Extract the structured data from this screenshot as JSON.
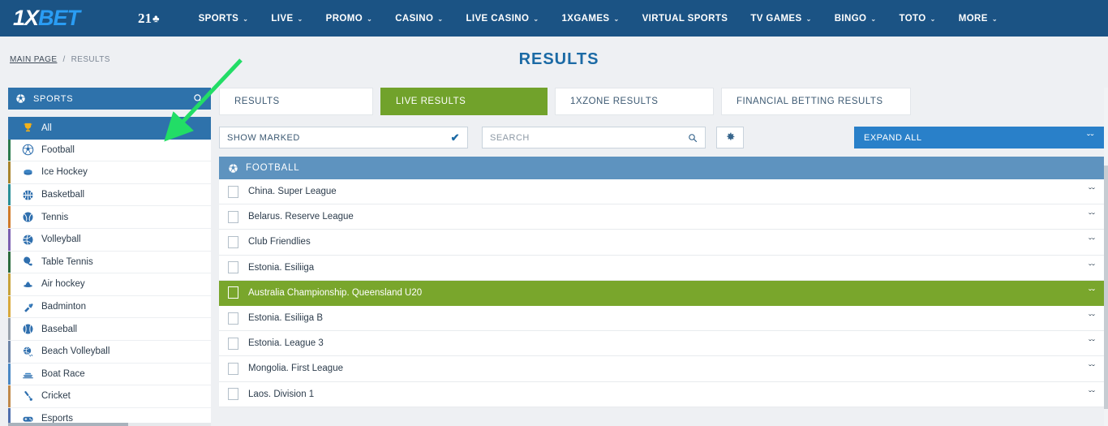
{
  "header": {
    "logo_1x": "1X",
    "logo_bet": "BET",
    "badge_21": "21",
    "badge_clover": "♣",
    "nav": [
      {
        "label": "SPORTS",
        "caret": true
      },
      {
        "label": "LIVE",
        "caret": true
      },
      {
        "label": "PROMO",
        "caret": true
      },
      {
        "label": "CASINO",
        "caret": true
      },
      {
        "label": "LIVE CASINO",
        "caret": true
      },
      {
        "label": "1XGAMES",
        "caret": true
      },
      {
        "label": "VIRTUAL SPORTS",
        "caret": false
      },
      {
        "label": "TV GAMES",
        "caret": true
      },
      {
        "label": "BINGO",
        "caret": true
      },
      {
        "label": "TOTO",
        "caret": true
      },
      {
        "label": "MORE",
        "caret": true
      }
    ],
    "caret_glyph": "⌄"
  },
  "breadcrumb": {
    "home": "MAIN PAGE",
    "separator": "/",
    "current": "RESULTS"
  },
  "page_title": "RESULTS",
  "sidebar": {
    "header_label": "SPORTS",
    "items": [
      {
        "label": "All",
        "icon": "trophy-icon",
        "strip": "#2e72ab",
        "active": true
      },
      {
        "label": "Football",
        "icon": "football-icon",
        "strip": "#2b7a4b",
        "active": false
      },
      {
        "label": "Ice Hockey",
        "icon": "ice-hockey-icon",
        "strip": "#a8842c",
        "active": false
      },
      {
        "label": "Basketball",
        "icon": "basketball-icon",
        "strip": "#2a8f96",
        "active": false
      },
      {
        "label": "Tennis",
        "icon": "tennis-icon",
        "strip": "#d07a2a",
        "active": false
      },
      {
        "label": "Volleyball",
        "icon": "volleyball-icon",
        "strip": "#7b5fb0",
        "active": false
      },
      {
        "label": "Table Tennis",
        "icon": "table-tennis-icon",
        "strip": "#2b6b3d",
        "active": false
      },
      {
        "label": "Air hockey",
        "icon": "air-hockey-icon",
        "strip": "#c7a23a",
        "active": false
      },
      {
        "label": "Badminton",
        "icon": "badminton-icon",
        "strip": "#d8a93c",
        "active": false
      },
      {
        "label": "Baseball",
        "icon": "baseball-icon",
        "strip": "#9aa3ad",
        "active": false
      },
      {
        "label": "Beach Volleyball",
        "icon": "beach-volleyball-icon",
        "strip": "#6f86a8",
        "active": false
      },
      {
        "label": "Boat Race",
        "icon": "boat-race-icon",
        "strip": "#4a88c4",
        "active": false
      },
      {
        "label": "Cricket",
        "icon": "cricket-icon",
        "strip": "#c0894a",
        "active": false
      },
      {
        "label": "Esports",
        "icon": "esports-icon",
        "strip": "#4f6fae",
        "active": false
      }
    ]
  },
  "tabs": [
    {
      "label": "RESULTS",
      "active": false
    },
    {
      "label": "LIVE RESULTS",
      "active": true
    },
    {
      "label": "1XZONE RESULTS",
      "active": false
    },
    {
      "label": "FINANCIAL BETTING RESULTS",
      "active": false
    }
  ],
  "filters": {
    "show_marked_label": "SHOW MARKED",
    "show_marked_checked": true,
    "check_glyph": "✔",
    "search_placeholder": "SEARCH",
    "search_value": "",
    "gear_label": "settings",
    "expand_all_label": "EXPAND ALL",
    "expand_glyph": "ˇˇ"
  },
  "category": {
    "label": "FOOTBALL",
    "icon": "football-icon"
  },
  "leagues": [
    {
      "label": "China. Super League",
      "marked": false,
      "checked": false
    },
    {
      "label": "Belarus. Reserve League",
      "marked": false,
      "checked": false
    },
    {
      "label": "Club Friendlies",
      "marked": false,
      "checked": false
    },
    {
      "label": "Estonia. Esiliiga",
      "marked": false,
      "checked": false
    },
    {
      "label": "Australia Championship. Queensland U20",
      "marked": true,
      "checked": false
    },
    {
      "label": "Estonia. Esiliiga B",
      "marked": false,
      "checked": false
    },
    {
      "label": "Estonia. League 3",
      "marked": false,
      "checked": false
    },
    {
      "label": "Mongolia. First League",
      "marked": false,
      "checked": false
    },
    {
      "label": "Laos. Division 1",
      "marked": false,
      "checked": false
    }
  ],
  "colors": {
    "header_blue": "#1b5384",
    "accent_blue": "#2e72ab",
    "bright_blue": "#2980c9",
    "green": "#71a22b",
    "marked_green": "#79a62c",
    "cat_blue": "#5e93bf",
    "annotation_green": "#22dd66"
  }
}
